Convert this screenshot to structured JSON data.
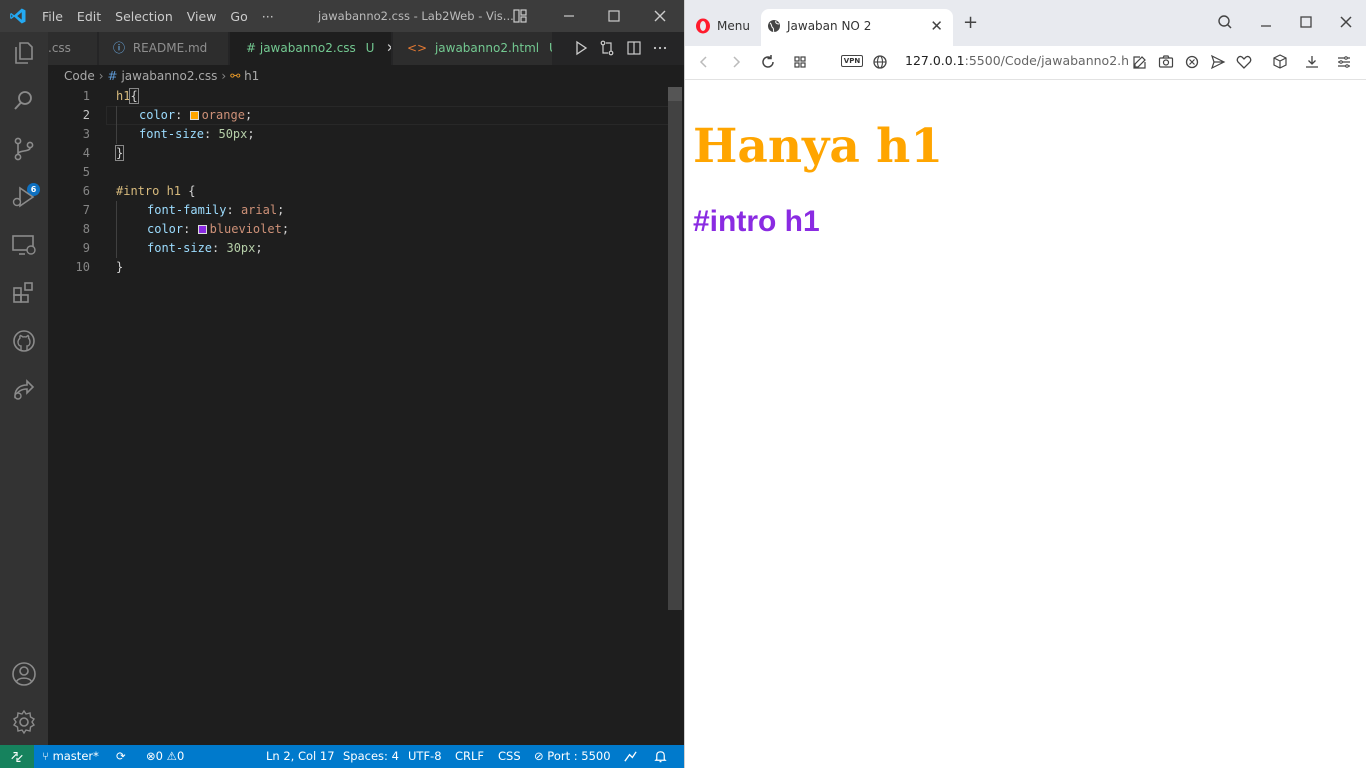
{
  "vscode": {
    "menu": [
      "File",
      "Edit",
      "Selection",
      "View",
      "Go",
      "···"
    ],
    "window_title": "jawabanno2.css - Lab2Web - Vis...",
    "tabs": [
      {
        "label": ".css",
        "modified": "",
        "type": "css",
        "active": false
      },
      {
        "label": "README.md",
        "modified": "",
        "type": "info",
        "active": false
      },
      {
        "label": "# jawabanno2.css",
        "modified": "U",
        "type": "css",
        "active": true
      },
      {
        "label": "jawabanno2.html",
        "modified": "U",
        "type": "html",
        "active": false
      }
    ],
    "breadcrumb": {
      "folder": "Code",
      "file_hash": "#",
      "file": "jawabanno2.css",
      "symbol": "h1"
    },
    "line_numbers": [
      "1",
      "2",
      "3",
      "4",
      "5",
      "6",
      "7",
      "8",
      "9",
      "10"
    ],
    "code": {
      "l1_selector": "h1",
      "l1_brace": "{",
      "l2_prop": "color",
      "l2_value": "orange",
      "l3_prop": "font-size",
      "l3_value": "50px",
      "l4_brace": "}",
      "l6_selector": "#intro h1",
      "l6_brace": "{",
      "l7_prop": "font-family",
      "l7_value": "arial",
      "l8_prop": "color",
      "l8_value": "blueviolet",
      "l9_prop": "font-size",
      "l9_value": "30px",
      "l10_brace": "}"
    },
    "swatch_colors": {
      "orange": "#ffa500",
      "blueviolet": "#8a2be2"
    },
    "scm_badge": "6",
    "status": {
      "branch": "master*",
      "errors": "0",
      "warnings": "0",
      "position": "Ln 2, Col 17",
      "spaces": "Spaces: 4",
      "encoding": "UTF-8",
      "eol": "CRLF",
      "language": "CSS",
      "port": "Port : 5500"
    },
    "colors": {
      "statusbar": "#007acc",
      "activitybar": "#333333",
      "editor": "#1e1e1e"
    }
  },
  "browser": {
    "menu_label": "Menu",
    "tab_title": "Jawaban NO 2",
    "url_host": "127.0.0.1",
    "url_rest": ":5500/Code/jawabanno2.h",
    "vpn_label": "VPN",
    "page": {
      "h1_text": "Hanya h1",
      "intro_text": "#intro h1"
    }
  }
}
